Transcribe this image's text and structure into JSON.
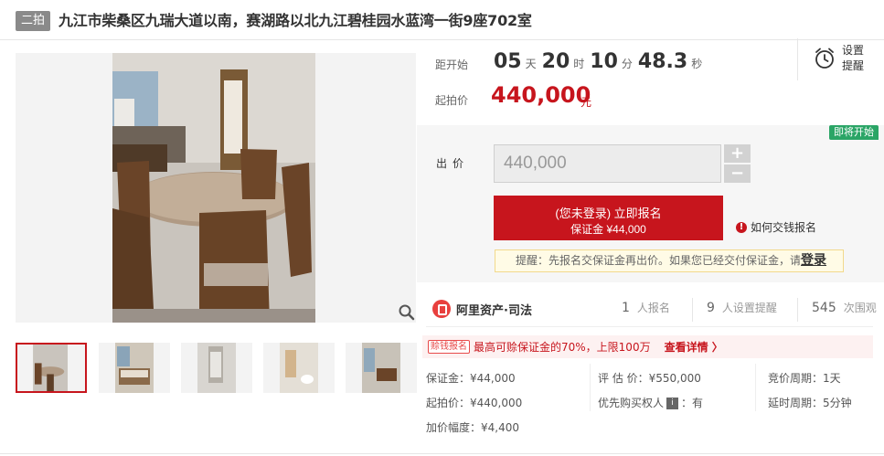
{
  "header": {
    "lot_tag": "二拍",
    "title": "九江市柴桑区九瑞大道以南，赛湖路以北九江碧桂园水蓝湾一街9座702室"
  },
  "countdown": {
    "label": "距开始",
    "days": "05",
    "days_unit": "天",
    "hours": "20",
    "hours_unit": "时",
    "minutes": "10",
    "minutes_unit": "分",
    "seconds": "48.3",
    "seconds_unit": "秒"
  },
  "reminder": {
    "label": "设置提醒",
    "icon": "alarm-clock-icon"
  },
  "start_price": {
    "label": "起拍价",
    "value": "440,000",
    "unit": "元"
  },
  "bid": {
    "status_badge": "即将开始",
    "label": "出价",
    "input_value": "440,000",
    "plus": "+",
    "minus": "−",
    "apply_line1": "(您未登录) 立即报名",
    "apply_line2": "保证金 ¥44,000",
    "howto": "如何交钱报名",
    "hint_text": "提醒：先报名交保证金再出价。如果您已经交付保证金，请",
    "hint_link": "登录"
  },
  "platform": {
    "brand": "阿里资产·司法",
    "signups": "1",
    "signups_label": "人报名",
    "reminders": "9",
    "reminders_label": "人设置提醒",
    "views": "545",
    "views_label": "次围观"
  },
  "promo": {
    "tag": "赊钱报名",
    "text": "最高可赊保证金的70%，上限100万",
    "detail": "查看详情 〉"
  },
  "facts": {
    "deposit": "保证金：¥44,000",
    "start_price": "起拍价：¥440,000",
    "increment": "加价幅度：¥4,400",
    "appraisal": "评 估 价：¥550,000",
    "priority_prefix": "优先购买权人",
    "priority_badge": "i",
    "priority_suffix": "：有",
    "period": "竞价周期：1天",
    "delay": "延时周期：5分钟"
  },
  "colors": {
    "accent": "#c7151d",
    "badge_green": "#2aa566",
    "tag_gray": "#8a8a8a"
  }
}
